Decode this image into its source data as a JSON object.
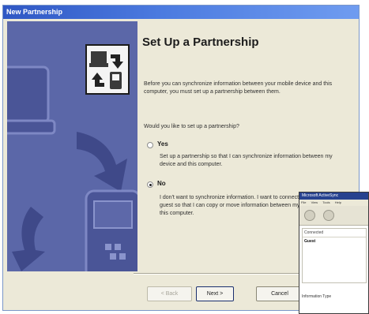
{
  "window": {
    "title": "New Partnership"
  },
  "heading": "Set Up a Partnership",
  "intro": "Before you can synchronize information between your mobile device and this computer, you must set up a partnership between them.",
  "question": "Would you like to set up a partnership?",
  "options": [
    {
      "label": "Yes",
      "selected": false,
      "description": "Set up a partnership so that I can synchronize information between my device and this computer."
    },
    {
      "label": "No",
      "selected": true,
      "description": "I don't want to synchronize information. I want to connect my device as a guest so that I can copy or move information between my device and this computer."
    }
  ],
  "buttons": {
    "back": "< Back",
    "next": "Next >",
    "cancel": "Cancel"
  },
  "popup": {
    "title": "Microsoft ActiveSync",
    "menu": [
      "File",
      "View",
      "Tools",
      "Help"
    ],
    "list_header": "Connected",
    "list_item": "Guest",
    "info_label": "Information Type"
  },
  "colors": {
    "art_panel": "#5b67a8",
    "titlebar": "#2f57c4",
    "dialog_bg": "#ece9d8"
  }
}
